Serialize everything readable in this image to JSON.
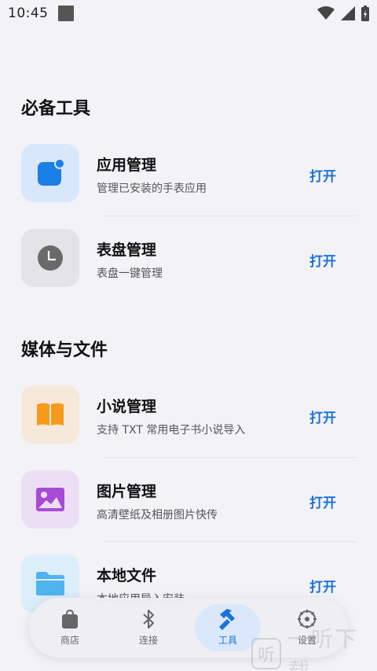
{
  "status": {
    "time": "10:45"
  },
  "sections": [
    {
      "title": "必备工具"
    },
    {
      "title": "媒体与文件"
    }
  ],
  "rows": [
    {
      "title": "应用管理",
      "subtitle": "管理已安装的手表应用",
      "action": "打开",
      "icon": "app-square-icon",
      "tile_color": "#d9e7fb"
    },
    {
      "title": "表盘管理",
      "subtitle": "表盘一键管理",
      "action": "打开",
      "icon": "clock-icon",
      "tile_color": "#e3e3e8"
    },
    {
      "title": "小说管理",
      "subtitle": "支持 TXT 常用电子书小说导入",
      "action": "打开",
      "icon": "book-icon",
      "tile_color": "#f7e9da"
    },
    {
      "title": "图片管理",
      "subtitle": "高清壁纸及相册图片快传",
      "action": "打开",
      "icon": "image-icon",
      "tile_color": "#ecdff5"
    },
    {
      "title": "本地文件",
      "subtitle": "本地应用导入安装",
      "action": "打开",
      "icon": "folder-icon",
      "tile_color": "#dceefa"
    }
  ],
  "nav": [
    {
      "label": "商店",
      "icon": "bag-icon"
    },
    {
      "label": "连接",
      "icon": "bluetooth-icon"
    },
    {
      "label": "工具",
      "icon": "hammer-icon",
      "active": true
    },
    {
      "label": "设置",
      "icon": "gear-icon"
    }
  ],
  "watermark": {
    "logo": "听",
    "text": "一听下载"
  },
  "colors": {
    "accent": "#1a73d9",
    "background": "#f3f2f7"
  }
}
